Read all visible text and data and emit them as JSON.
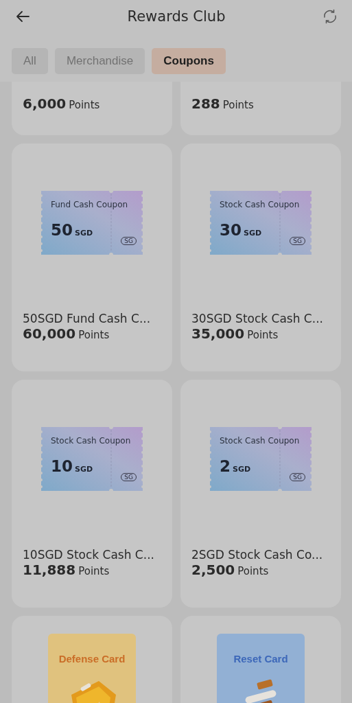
{
  "header": {
    "title": "Rewards Club"
  },
  "tabs": [
    {
      "label": "All",
      "selected": false
    },
    {
      "label": "Merchandise",
      "selected": false
    },
    {
      "label": "Coupons",
      "selected": true
    }
  ],
  "partial_items": [
    {
      "points": "6,000",
      "unit": "Points"
    },
    {
      "points": "288",
      "unit": "Points"
    }
  ],
  "items": [
    {
      "kind": "coupon",
      "coupon_label": "Fund Cash Coupon",
      "amount": "50",
      "currency": "SGD",
      "region": "SG",
      "title": "50SGD Fund Cash C...",
      "points": "60,000",
      "unit": "Points"
    },
    {
      "kind": "coupon",
      "coupon_label": "Stock Cash Coupon",
      "amount": "30",
      "currency": "SGD",
      "region": "SG",
      "title": "30SGD Stock Cash C...",
      "points": "35,000",
      "unit": "Points"
    },
    {
      "kind": "coupon",
      "coupon_label": "Stock Cash Coupon",
      "amount": "10",
      "currency": "SGD",
      "region": "SG",
      "title": "10SGD Stock Cash C...",
      "points": "11,888",
      "unit": "Points"
    },
    {
      "kind": "coupon",
      "coupon_label": "Stock Cash Coupon",
      "amount": "2",
      "currency": "SGD",
      "region": "SG",
      "title": "2SGD Stock Cash Co...",
      "points": "2,500",
      "unit": "Points"
    },
    {
      "kind": "defense",
      "card_label": "Defense Card",
      "color": "#e0c27e"
    },
    {
      "kind": "reset",
      "card_label": "Reset Card",
      "color": "#92b0d4"
    }
  ]
}
